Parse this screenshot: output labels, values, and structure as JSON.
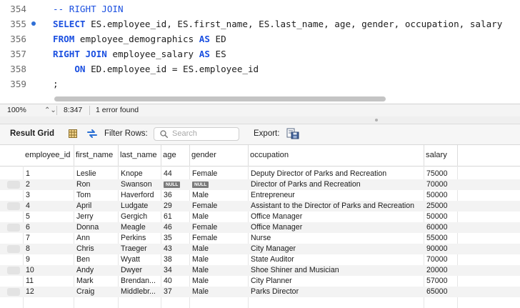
{
  "editor": {
    "lines": [
      {
        "num": "354",
        "segments": [
          {
            "t": "-- RIGHT JOIN",
            "c": "cm"
          }
        ]
      },
      {
        "num": "355",
        "marker": true,
        "segments": [
          {
            "t": "SELECT",
            "c": "kw"
          },
          {
            "t": " ES.employee_id, ES.first_name, ES.last_name, age, gender, occupation, salary",
            "c": ""
          }
        ]
      },
      {
        "num": "356",
        "segments": [
          {
            "t": "FROM",
            "c": "kw"
          },
          {
            "t": " employee_demographics ",
            "c": ""
          },
          {
            "t": "AS",
            "c": "kw"
          },
          {
            "t": " ED",
            "c": ""
          }
        ]
      },
      {
        "num": "357",
        "segments": [
          {
            "t": "RIGHT JOIN",
            "c": "kw"
          },
          {
            "t": " employee_salary ",
            "c": ""
          },
          {
            "t": "AS",
            "c": "kw"
          },
          {
            "t": " ES",
            "c": ""
          }
        ]
      },
      {
        "num": "358",
        "segments": [
          {
            "t": "    ",
            "c": ""
          },
          {
            "t": "ON",
            "c": "kw"
          },
          {
            "t": " ED.employee_id = ES.employee_id",
            "c": ""
          }
        ]
      },
      {
        "num": "359",
        "segments": [
          {
            "t": ";",
            "c": ""
          }
        ]
      }
    ]
  },
  "status": {
    "zoom": "100%",
    "stepper": "⌃⌄",
    "position": "8:347",
    "errors": "1 error found"
  },
  "toolbar": {
    "result_grid": "Result Grid",
    "filter_rows": "Filter Rows:",
    "search_placeholder": "Search",
    "export": "Export:"
  },
  "table": {
    "columns": [
      "employee_id",
      "first_name",
      "last_name",
      "age",
      "gender",
      "occupation",
      "salary"
    ],
    "rows": [
      [
        "1",
        "Leslie",
        "Knope",
        "44",
        "Female",
        "Deputy Director of Parks and Recreation",
        "75000"
      ],
      [
        "2",
        "Ron",
        "Swanson",
        "NULL",
        "NULL",
        "Director of Parks and Recreation",
        "70000"
      ],
      [
        "3",
        "Tom",
        "Haverford",
        "36",
        "Male",
        "Entrepreneur",
        "50000"
      ],
      [
        "4",
        "April",
        "Ludgate",
        "29",
        "Female",
        "Assistant to the Director of Parks and Recreation",
        "25000"
      ],
      [
        "5",
        "Jerry",
        "Gergich",
        "61",
        "Male",
        "Office Manager",
        "50000"
      ],
      [
        "6",
        "Donna",
        "Meagle",
        "46",
        "Female",
        "Office Manager",
        "60000"
      ],
      [
        "7",
        "Ann",
        "Perkins",
        "35",
        "Female",
        "Nurse",
        "55000"
      ],
      [
        "8",
        "Chris",
        "Traeger",
        "43",
        "Male",
        "City Manager",
        "90000"
      ],
      [
        "9",
        "Ben",
        "Wyatt",
        "38",
        "Male",
        "State Auditor",
        "70000"
      ],
      [
        "10",
        "Andy",
        "Dwyer",
        "34",
        "Male",
        "Shoe Shiner and Musician",
        "20000"
      ],
      [
        "11",
        "Mark",
        "Brendan...",
        "40",
        "Male",
        "City Planner",
        "57000"
      ],
      [
        "12",
        "Craig",
        "Middlebr...",
        "37",
        "Male",
        "Parks Director",
        "65000"
      ]
    ]
  },
  "colors": {
    "keyword": "#1a4fe0",
    "marker": "#2f6fd6",
    "null_badge": "#7a7a7a"
  },
  "icons": {
    "grid_view": "grid-view-icon",
    "refresh": "refresh-icon",
    "search": "search-icon",
    "export": "export-icon"
  }
}
